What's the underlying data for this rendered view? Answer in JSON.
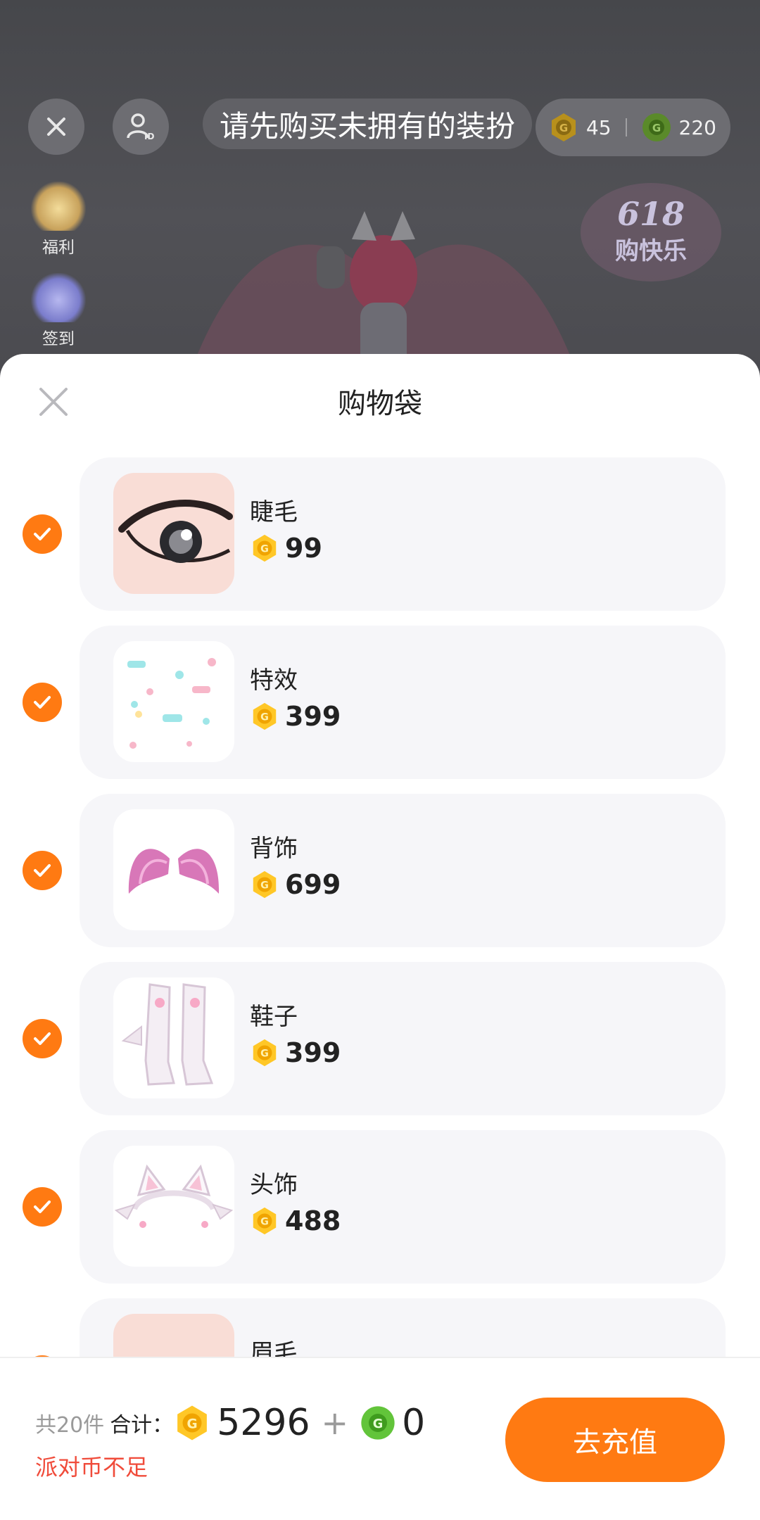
{
  "toast": {
    "text": "请先购买未拥有的装扮"
  },
  "wallet": {
    "gold_coins": "45",
    "green_coins": "220"
  },
  "side_entries": [
    {
      "label": "福利"
    },
    {
      "label": "签到"
    }
  ],
  "sheet": {
    "title": "购物袋"
  },
  "items": [
    {
      "name": "睫毛",
      "price": "99",
      "checked": true,
      "icon": "eyelash-thumbnail"
    },
    {
      "name": "特效",
      "price": "399",
      "checked": true,
      "icon": "effect-thumbnail"
    },
    {
      "name": "背饰",
      "price": "699",
      "checked": true,
      "icon": "wings-thumbnail"
    },
    {
      "name": "鞋子",
      "price": "399",
      "checked": true,
      "icon": "boots-thumbnail"
    },
    {
      "name": "头饰",
      "price": "488",
      "checked": true,
      "icon": "cat-ears-thumbnail"
    },
    {
      "name": "眉毛",
      "price": "",
      "checked": true,
      "icon": "eyebrow-thumbnail"
    }
  ],
  "footer": {
    "count": "共20件",
    "total_label": "合计：",
    "gold_total": "5296",
    "plus": "+",
    "green_total": "0",
    "warning": "派对币不足",
    "recharge_label": "去充值"
  },
  "colors": {
    "accent": "#ff7a12",
    "warning": "#f04b3a",
    "card_bg": "#f6f6f9"
  }
}
